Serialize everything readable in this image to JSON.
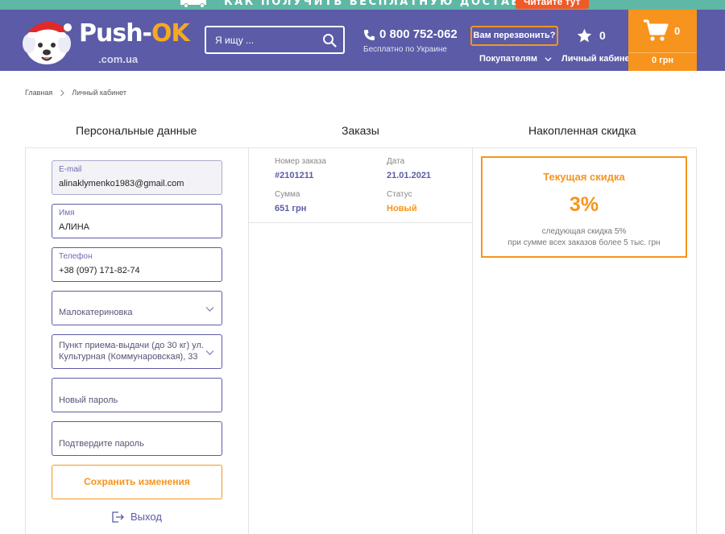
{
  "promo": {
    "text": "КАК ПОЛУЧИТЬ БЕСПЛАТНУЮ ДОСТАВКУ?",
    "button": "Читайте тут"
  },
  "header": {
    "logo_main": "Push-",
    "logo_ok": "OK",
    "logo_sub": ".com.ua",
    "search_placeholder": "Я ищу ...",
    "phone": "0 800 752-062",
    "phone_sub": "Бесплатно по Украине",
    "callback": "Вам перезвонить?",
    "buyers": "Покупателям",
    "favorites_count": "0",
    "cabinet": "Личный кабинет",
    "cart_count": "0",
    "cart_total": "0 грн"
  },
  "breadcrumb": {
    "home": "Главная",
    "current": "Личный кабинет"
  },
  "sections": {
    "personal": "Персональные данные",
    "orders": "Заказы",
    "discount": "Накопленная скидка"
  },
  "form": {
    "email_label": "E-mail",
    "email_value": "alinaklymenko1983@gmail.com",
    "name_label": "Имя",
    "name_value": "АЛИНА",
    "phone_label": "Телефон",
    "phone_value": "+38 (097) 171-82-74",
    "city": "Малокатериновка",
    "delivery_point": "Пункт приема-выдачи (до 30 кг) ул. Культурная (Коммунаровская), 33",
    "new_password": "Новый пароль",
    "confirm_password": "Подтвердите пароль",
    "save": "Сохранить изменения",
    "logout": "Выход"
  },
  "order": {
    "number_label": "Номер заказа",
    "number": "#2101211",
    "date_label": "Дата",
    "date": "21.01.2021",
    "sum_label": "Сумма",
    "sum": "651 грн",
    "status_label": "Статус",
    "status": "Новый"
  },
  "discount": {
    "title": "Текущая скидка",
    "value": "3%",
    "next": "следующая скидка 5%",
    "condition": "при сумме всех заказов более 5 тыс. грн"
  },
  "colors": {
    "header": "#5b5ba8",
    "accent": "#f7941d",
    "promo": "#5fb7a6"
  }
}
